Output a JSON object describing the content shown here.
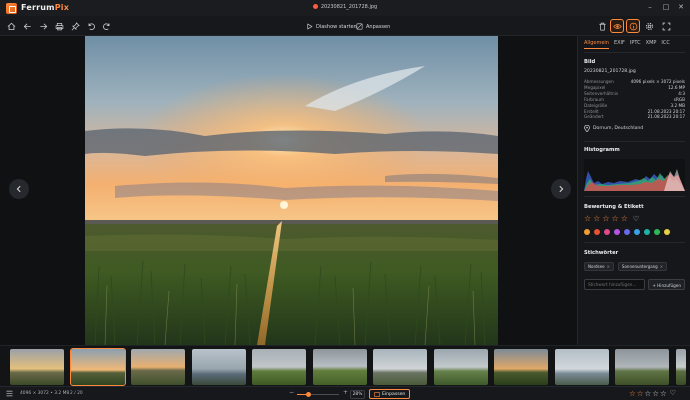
{
  "app": {
    "name_part1": "Ferrum",
    "name_part2": "Pix",
    "file_title": "20230821_201728.jpg"
  },
  "window_controls": [
    "–",
    "□",
    "✕"
  ],
  "toolbar": {
    "slideshow_label": "Diashow starten",
    "adjust_label": "Anpassen"
  },
  "panel": {
    "tabs": [
      "Allgemein",
      "EXIF",
      "IPTC",
      "XMP",
      "ICC"
    ],
    "active_tab": "Allgemein",
    "image_section": {
      "title": "Bild",
      "filename": "20230821_201728.jpg",
      "rows": [
        {
          "key": "Abmessungen",
          "value": "4096 pixels × 3072 pixels"
        },
        {
          "key": "Megapixel",
          "value": "12.6 MP"
        },
        {
          "key": "Seitenverhältnis",
          "value": "4:3"
        },
        {
          "key": "Farbraum",
          "value": "sRGB"
        },
        {
          "key": "Dateigröße",
          "value": "3.2 MB"
        },
        {
          "key": "Erstellt",
          "value": "21.08.2023 20:17"
        },
        {
          "key": "Geändert",
          "value": "21.08.2023 20:17"
        }
      ],
      "location": "Dornum, Deutschland"
    },
    "histogram_title": "Histogramm",
    "rating_title": "Bewertung & Etikett",
    "rating": 0,
    "label_colors": [
      "#f0a030",
      "#e8532f",
      "#e04a8a",
      "#b455e6",
      "#6a6af0",
      "#3aa0e8",
      "#1fb3a8",
      "#2fb85a",
      "#e8d040"
    ],
    "keywords_title": "Stichwörter",
    "keywords": [
      "Nordsee",
      "Sonnenuntergang"
    ],
    "keyword_placeholder": "Stichwort hinzufügen...",
    "keyword_add_label": "+ Hinzufügen"
  },
  "statusbar": {
    "info": "4096 × 3072 • 3.2 MB",
    "position": "2 / 20",
    "zoom": "28%",
    "zoom_level": 0.28,
    "fit_label": "Einpassen",
    "rating": 0
  },
  "thumbnails": [
    {
      "name": "sunset-marsh"
    },
    {
      "name": "sunset-field"
    },
    {
      "name": "sunset-horizon"
    },
    {
      "name": "harbor-cloudy"
    },
    {
      "name": "green-meadow"
    },
    {
      "name": "cloudy-field"
    },
    {
      "name": "coast-road"
    },
    {
      "name": "dyke-path"
    },
    {
      "name": "sunset-grass"
    },
    {
      "name": "harbor-boats"
    },
    {
      "name": "grey-meadow"
    },
    {
      "name": "edge-partial"
    }
  ],
  "colors": {
    "accent": "#ff8a3d",
    "panel_bg": "#15171a",
    "app_bg": "#111315"
  }
}
